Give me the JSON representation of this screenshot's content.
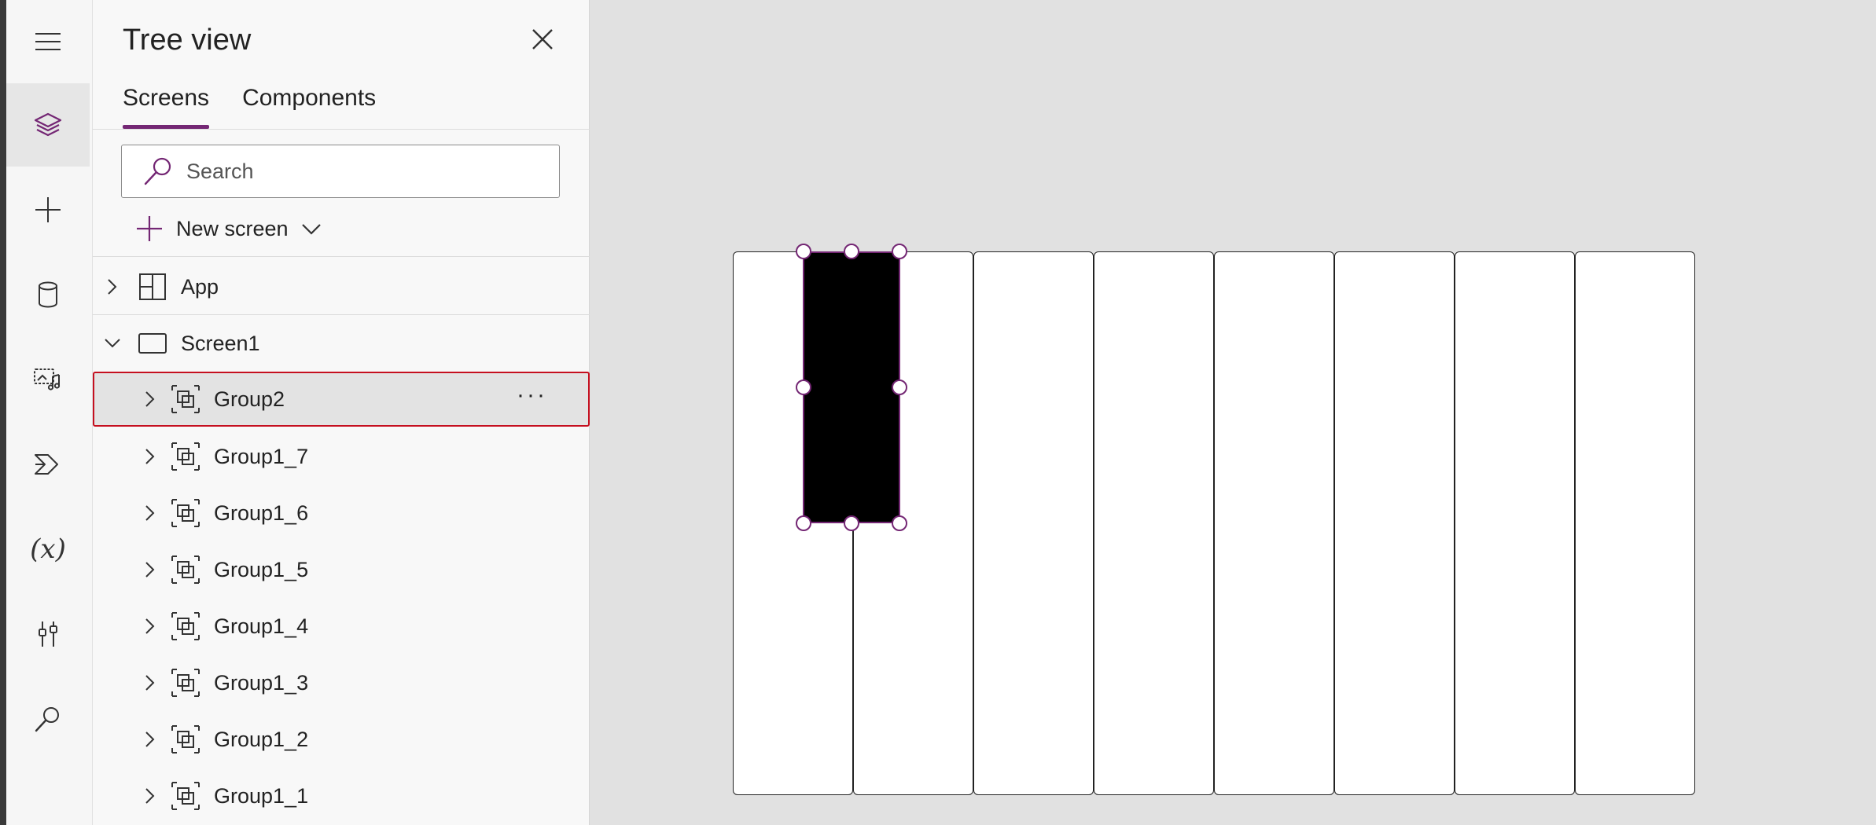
{
  "rail": {
    "items": [
      {
        "name": "hamburger-menu-icon",
        "active": false
      },
      {
        "name": "tree-view-layers-icon",
        "active": true
      },
      {
        "name": "insert-plus-icon",
        "active": false
      },
      {
        "name": "data-cylinder-icon",
        "active": false
      },
      {
        "name": "media-icon",
        "active": false
      },
      {
        "name": "power-automate-icon",
        "active": false
      },
      {
        "name": "variables-icon",
        "active": false,
        "glyph": "(x)"
      },
      {
        "name": "advanced-tools-icon",
        "active": false
      },
      {
        "name": "search-icon",
        "active": false
      }
    ]
  },
  "panel": {
    "title": "Tree view",
    "tabs": [
      {
        "label": "Screens",
        "active": true
      },
      {
        "label": "Components",
        "active": false
      }
    ],
    "search_placeholder": "Search",
    "new_screen_label": "New screen"
  },
  "tree": {
    "items": [
      {
        "label": "App",
        "level": 0,
        "expanded": false,
        "icon": "app-icon"
      },
      {
        "label": "Screen1",
        "level": 0,
        "expanded": true,
        "icon": "screen-icon"
      },
      {
        "label": "Group2",
        "level": 1,
        "expanded": false,
        "icon": "group-icon",
        "selected": true,
        "more": "···"
      },
      {
        "label": "Group1_7",
        "level": 1,
        "expanded": false,
        "icon": "group-icon"
      },
      {
        "label": "Group1_6",
        "level": 1,
        "expanded": false,
        "icon": "group-icon"
      },
      {
        "label": "Group1_5",
        "level": 1,
        "expanded": false,
        "icon": "group-icon"
      },
      {
        "label": "Group1_4",
        "level": 1,
        "expanded": false,
        "icon": "group-icon"
      },
      {
        "label": "Group1_3",
        "level": 1,
        "expanded": false,
        "icon": "group-icon"
      },
      {
        "label": "Group1_2",
        "level": 1,
        "expanded": false,
        "icon": "group-icon"
      },
      {
        "label": "Group1_1",
        "level": 1,
        "expanded": false,
        "icon": "group-icon"
      }
    ]
  },
  "colors": {
    "accent": "#742774",
    "selection_border": "#c50f1f",
    "canvas_bg": "#e1e1e1",
    "panel_bg": "#f8f8f8"
  }
}
